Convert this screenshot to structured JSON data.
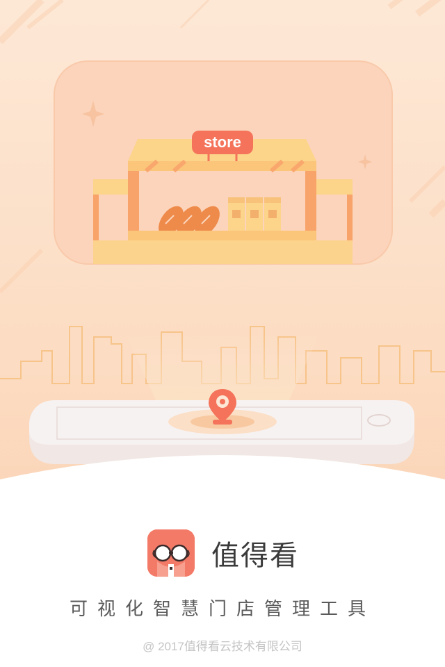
{
  "illustration": {
    "store_sign": "store"
  },
  "brand": {
    "app_name": "值得看",
    "icon": "goggles-mascot-icon"
  },
  "tagline": "可视化智慧门店管理工具",
  "copyright": "@ 2017值得看云技术有限公司",
  "colors": {
    "accent": "#f4735a",
    "background_top": "#fde8d6",
    "background_bottom": "#fbd5b8",
    "card": "#fbd4bb",
    "awning": "#fcd48a",
    "bread": "#ee8a4a"
  }
}
